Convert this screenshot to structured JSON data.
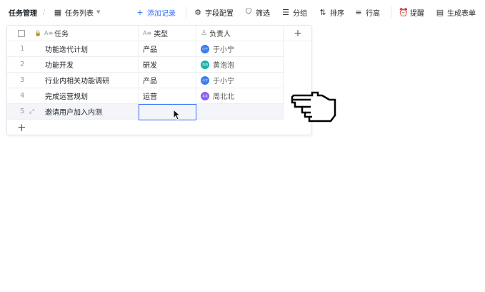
{
  "toolbar": {
    "app_title": "任务管理",
    "view_name": "任务列表",
    "add_record": "添加记录",
    "field_config": "字段配置",
    "filter": "筛选",
    "group": "分组",
    "sort": "排序",
    "row_height": "行高",
    "reminder": "提醒",
    "create_form": "生成表单"
  },
  "table": {
    "columns": [
      "任务",
      "类型",
      "负责人"
    ],
    "rows": [
      {
        "num": "1",
        "task": "功能迭代计划",
        "type": "产品",
        "owner": "于小宁",
        "avatar": "小宁",
        "color": "#3b7cf0"
      },
      {
        "num": "2",
        "task": "功能开发",
        "type": "研发",
        "owner": "黄泡泡",
        "avatar": "泡泡",
        "color": "#14b3a4"
      },
      {
        "num": "3",
        "task": "行业内相关功能调研",
        "type": "产品",
        "owner": "于小宁",
        "avatar": "小宁",
        "color": "#3b7cf0"
      },
      {
        "num": "4",
        "task": "完成运营规划",
        "type": "运营",
        "owner": "周北北",
        "avatar": "北北",
        "color": "#8a5cf0"
      },
      {
        "num": "5",
        "task": "邀请用户加入内测",
        "type": "",
        "owner": "",
        "avatar": "",
        "color": ""
      }
    ]
  },
  "colors": {
    "accent": "#3370ff"
  }
}
